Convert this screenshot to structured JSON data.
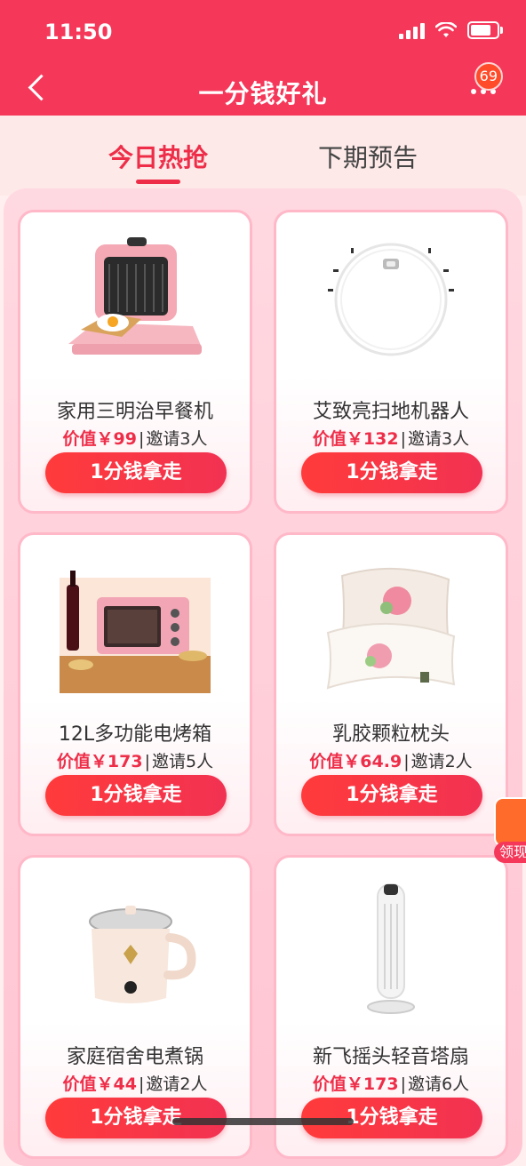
{
  "status": {
    "time": "11:50"
  },
  "header": {
    "title": "一分钱好礼",
    "badge_count": "69"
  },
  "tabs": [
    {
      "label": "今日热抢",
      "active": true
    },
    {
      "label": "下期预告",
      "active": false
    }
  ],
  "products": [
    {
      "name": "家用三明治早餐机",
      "price": "价值￥99",
      "sep": "|",
      "invite": "邀请3人",
      "button": "1分钱拿走"
    },
    {
      "name": "艾致亮扫地机器人",
      "price": "价值￥132",
      "sep": "|",
      "invite": "邀请3人",
      "button": "1分钱拿走"
    },
    {
      "name": "12L多功能电烤箱",
      "price": "价值￥173",
      "sep": "|",
      "invite": "邀请5人",
      "button": "1分钱拿走"
    },
    {
      "name": "乳胶颗粒枕头",
      "price": "价值￥64.9",
      "sep": "|",
      "invite": "邀请2人",
      "button": "1分钱拿走"
    },
    {
      "name": "家庭宿舍电煮锅",
      "price": "价值￥44",
      "sep": "|",
      "invite": "邀请2人",
      "button": "1分钱拿走"
    },
    {
      "name": "新飞摇头轻音塔扇",
      "price": "价值￥173",
      "sep": "|",
      "invite": "邀请6人",
      "button": "1分钱拿走"
    }
  ],
  "float": {
    "label": "领现"
  },
  "colors": {
    "brand": "#f5385a",
    "accent": "#ee2e49"
  }
}
